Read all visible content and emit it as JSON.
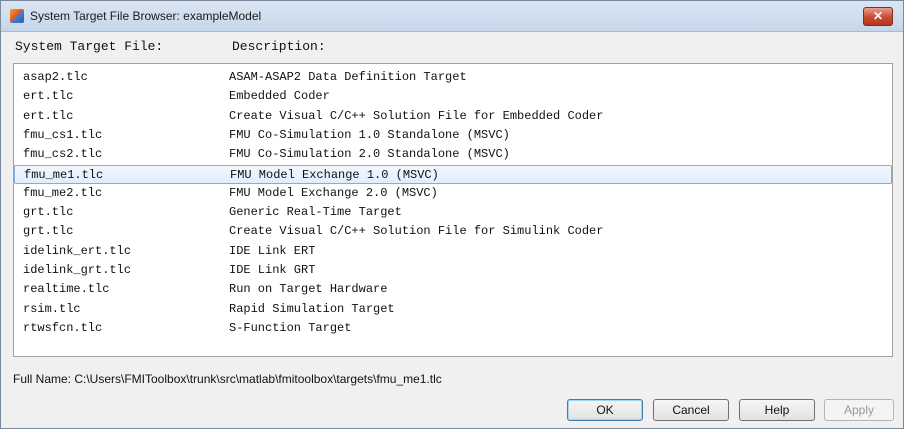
{
  "window": {
    "title": "System Target File Browser: exampleModel",
    "close_label": "✕"
  },
  "headers": {
    "file": "System Target File:",
    "description": "Description:"
  },
  "rows": [
    {
      "file": "asap2.tlc",
      "description": "ASAM-ASAP2 Data Definition Target"
    },
    {
      "file": "ert.tlc",
      "description": "Embedded Coder"
    },
    {
      "file": "ert.tlc",
      "description": "Create Visual C/C++ Solution File for Embedded Coder"
    },
    {
      "file": "fmu_cs1.tlc",
      "description": "FMU Co-Simulation 1.0 Standalone (MSVC)"
    },
    {
      "file": "fmu_cs2.tlc",
      "description": "FMU Co-Simulation 2.0 Standalone (MSVC)"
    },
    {
      "file": "fmu_me1.tlc",
      "description": "FMU Model Exchange 1.0 (MSVC)"
    },
    {
      "file": "fmu_me2.tlc",
      "description": "FMU Model Exchange 2.0 (MSVC)"
    },
    {
      "file": "grt.tlc",
      "description": "Generic Real-Time Target"
    },
    {
      "file": "grt.tlc",
      "description": "Create Visual C/C++ Solution File for Simulink Coder"
    },
    {
      "file": "idelink_ert.tlc",
      "description": "IDE Link ERT"
    },
    {
      "file": "idelink_grt.tlc",
      "description": "IDE Link GRT"
    },
    {
      "file": "realtime.tlc",
      "description": "Run on Target Hardware"
    },
    {
      "file": "rsim.tlc",
      "description": "Rapid Simulation Target"
    },
    {
      "file": "rtwsfcn.tlc",
      "description": "S-Function Target"
    }
  ],
  "selected_index": 5,
  "fullname": "Full Name: C:\\Users\\FMIToolbox\\trunk\\src\\matlab\\fmitoolbox\\targets\\fmu_me1.tlc",
  "buttons": {
    "ok": "OK",
    "cancel": "Cancel",
    "help": "Help",
    "apply": "Apply"
  }
}
